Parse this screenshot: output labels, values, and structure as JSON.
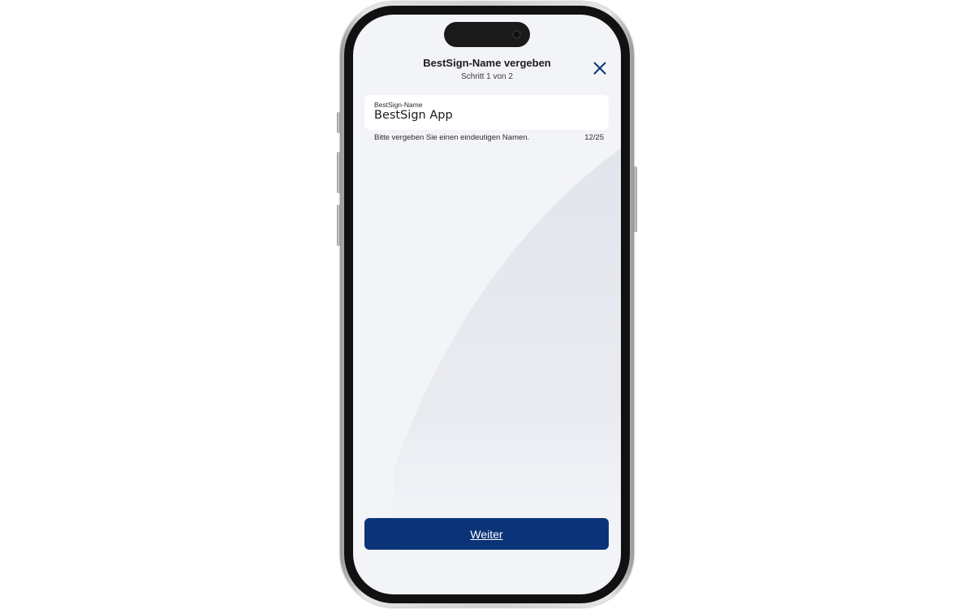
{
  "header": {
    "title": "BestSign-Name vergeben",
    "step": "Schritt 1 von 2",
    "close_icon": "close-icon"
  },
  "name_field": {
    "label": "BestSign-Name",
    "value": "BestSign App"
  },
  "helper": {
    "text": "Bitte vergeben Sie einen eindeutigen Namen.",
    "counter": "12/25"
  },
  "footer": {
    "continue_label": "Weiter"
  },
  "colors": {
    "primary": "#0a3477",
    "background": "#f3f4f8",
    "close_icon": "#0a3477"
  }
}
